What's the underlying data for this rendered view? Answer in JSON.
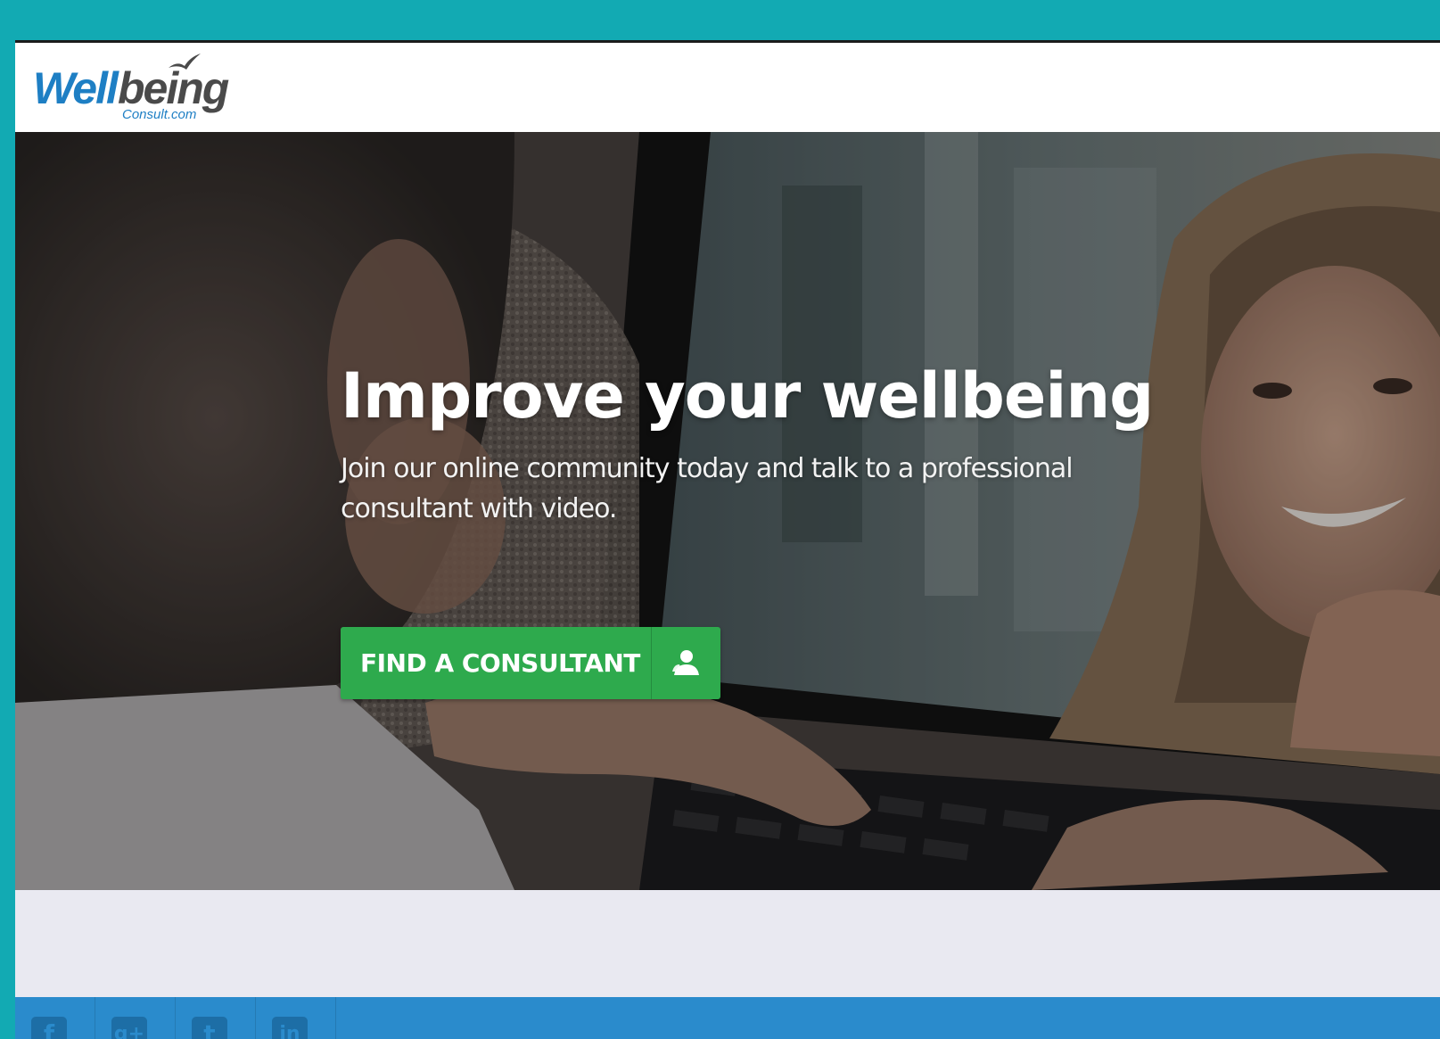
{
  "header": {
    "logo": {
      "primary": "Well",
      "secondary": "being",
      "sub": "Consult.com"
    }
  },
  "hero": {
    "title": "Improve your wellbeing",
    "subtitle": "Join our online community today and talk to a professional consultant with video.",
    "cta_label": "FIND A CONSULTANT",
    "cta_icon": "consultant-person-icon"
  },
  "footer": {
    "social": [
      {
        "name": "facebook-icon",
        "glyph": "f"
      },
      {
        "name": "google-plus-icon",
        "glyph": "g+"
      },
      {
        "name": "twitter-icon",
        "glyph": "t"
      },
      {
        "name": "linkedin-icon",
        "glyph": "in"
      }
    ]
  },
  "colors": {
    "page_background": "#12aab3",
    "logo_blue": "#1e7fc4",
    "logo_gray": "#4a4a4a",
    "cta_green": "#2eaa4d",
    "footer_blue": "#2a8bcc",
    "band_gray": "#e9e9f1"
  }
}
